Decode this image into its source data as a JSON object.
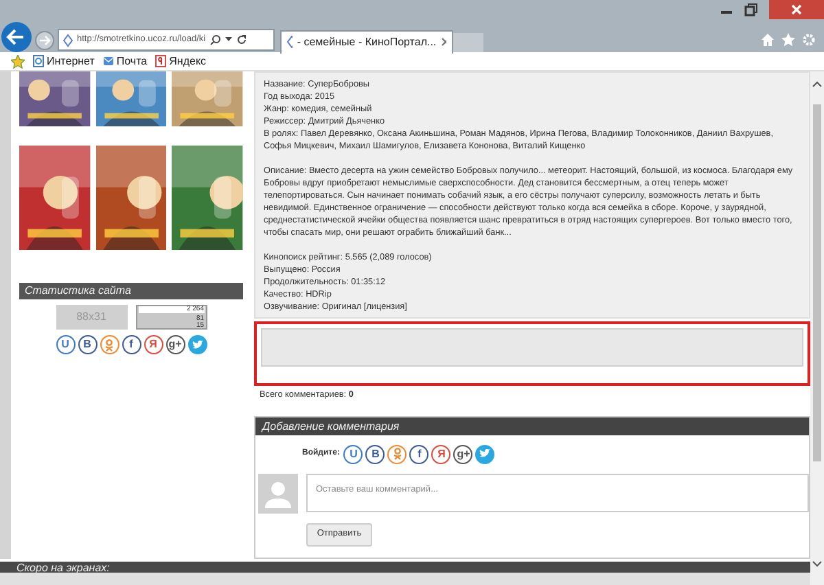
{
  "browser": {
    "address": "http://smotretkino.ucoz.ru/load/ki",
    "tab": {
      "title": "- семейные - КиноПортал...",
      "selected": true
    },
    "favorites": [
      {
        "label": "Интернет",
        "kind": "ie"
      },
      {
        "label": "Почта",
        "kind": "mail"
      },
      {
        "label": "Яндекс",
        "kind": "yandex"
      }
    ]
  },
  "stats": {
    "title": "Статистика сайта",
    "counter_1": "88x31",
    "counter_2": {
      "total": "2 264",
      "hits": "81",
      "hosts": "15"
    },
    "social": [
      {
        "kind": "letter",
        "label": "U",
        "color": "#3a7ad0"
      },
      {
        "kind": "letter",
        "label": "B",
        "color": "#3a5aa0"
      },
      {
        "kind": "ok",
        "color": "#f08a30"
      },
      {
        "kind": "letter",
        "label": "f",
        "color": "#3a5a9a"
      },
      {
        "kind": "letter",
        "label": "Я",
        "color": "#e04a3a"
      },
      {
        "kind": "letter",
        "label": "g+",
        "color": "#555555"
      },
      {
        "kind": "twitter",
        "color": "#2aa8e0"
      }
    ]
  },
  "login_social": [
    {
      "kind": "letter",
      "label": "U",
      "color": "#3a7ad0"
    },
    {
      "kind": "letter",
      "label": "B",
      "color": "#3a5aa0"
    },
    {
      "kind": "ok",
      "color": "#f08a30"
    },
    {
      "kind": "letter",
      "label": "f",
      "color": "#3a5a9a"
    },
    {
      "kind": "letter",
      "label": "Я",
      "color": "#e04a3a"
    },
    {
      "kind": "letter",
      "label": "g+",
      "color": "#555555"
    },
    {
      "kind": "twitter",
      "color": "#2aa8e0"
    }
  ],
  "film": {
    "lines": [
      "Название: СуперБобровы",
      "Год выхода: 2015",
      "Жанр: комедия, семейный",
      "Режиссер: Дмитрий Дьяченко",
      "В ролях: Павел Деревянко, Оксана Акиньшина, Роман Мадянов, Ирина Пегова, Владимир Толоконников, Даниил Вахрушев, Софья Мицкевич, Михаил Шамигулов, Елизавета Кононова, Виталий Кищенко"
    ],
    "description": "Описание: Вместо десерта на ужин семейство Бобровых получило... метеорит. Настоящий, большой, из космоса. Благодаря ему Бобровы вдруг приобретают немыслимые сверхспособности. Дед становится бессмертным, а отец теперь может телепортироваться. Сын начинает понимать собачий язык, а его сёстры получают суперсилу, возможность летать и быть невидимой. Единственное ограничение — способности действуют только когда вся семейка в сборе. Короче, у заурядной, среднестатистической ячейки общества появляется шанс превратиться в отряд настоящих супергероев. Вот только вместо того, чтобы спасать мир, они решают ограбить ближайший банк...",
    "details": [
      "Кинопоиск рейтинг: 5.565 (2,089 голосов)",
      "Выпущено: Россия",
      "Продолжительность: 01:35:12",
      "Качество: HDRip",
      "Озвучивание: Оригинал [лицензия]"
    ]
  },
  "comments": {
    "total": "Всего комментариев: **0**",
    "form_title": "Добавление комментария",
    "login_label": "Войдите:",
    "placeholder": "Оставьте ваш комментарий...",
    "submit": "Отправить"
  },
  "bottom_section": {
    "title": "Скоро на экранах:"
  }
}
